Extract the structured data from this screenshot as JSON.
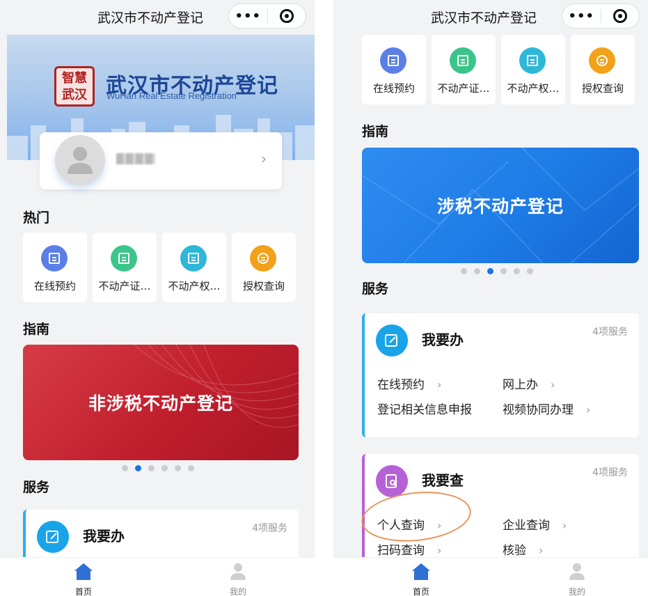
{
  "app_title": "武汉市不动产登记",
  "logo": {
    "seal": "智慧武汉",
    "title": "武汉市不动产登记",
    "subtitle": "WuHan Real Estate Registration"
  },
  "sections": {
    "hot": "热门",
    "guide": "指南",
    "service": "服务"
  },
  "tiles": [
    {
      "label": "在线预约",
      "icon": "calendar-icon",
      "color": "#5b7fe6"
    },
    {
      "label": "不动产证…",
      "icon": "scan-certificate-icon",
      "color": "#3cc58a"
    },
    {
      "label": "不动产权…",
      "icon": "document-icon",
      "color": "#2fb7d8"
    },
    {
      "label": "授权查询",
      "icon": "shield-search-icon",
      "color": "#f2a11a"
    }
  ],
  "banners": {
    "left": {
      "text": "非涉税不动产登记",
      "color": "#c81e2c",
      "active_dot": 1
    },
    "right": {
      "text": "涉税不动产登记",
      "color": "#1d7ce6",
      "active_dot": 2
    }
  },
  "services": {
    "do": {
      "title": "我要办",
      "count": "4项服务",
      "icon": "edit-icon",
      "color": "#19a4ea",
      "links": [
        "在线预约",
        "网上办",
        "登记相关信息申报",
        "视频协同办理"
      ]
    },
    "query": {
      "title": "我要查",
      "count": "4项服务",
      "icon": "search-document-icon",
      "color": "#b761d6",
      "links": [
        "个人查询",
        "企业查询",
        "扫码查询",
        "核验"
      ]
    }
  },
  "tabbar": {
    "home": "首页",
    "mine": "我的",
    "active_color": "#2f6fd6"
  }
}
